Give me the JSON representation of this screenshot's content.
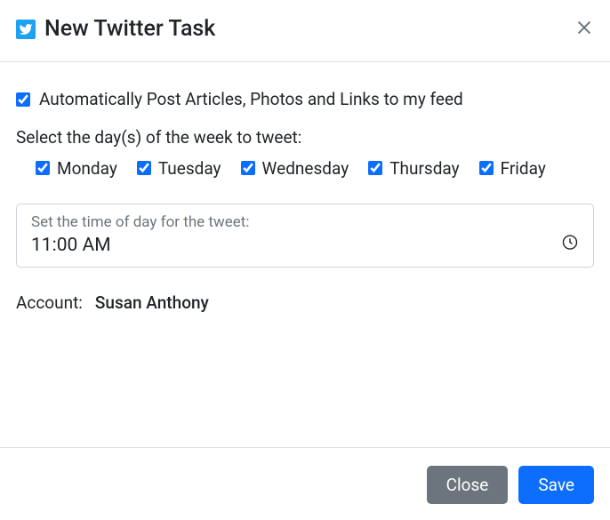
{
  "header": {
    "title": "New Twitter Task"
  },
  "body": {
    "auto_post": {
      "checked": true,
      "label": "Automatically Post Articles, Photos and Links to my feed"
    },
    "days_label": "Select the day(s) of the week to tweet:",
    "days": {
      "monday": {
        "label": "Monday",
        "checked": true
      },
      "tuesday": {
        "label": "Tuesday",
        "checked": true
      },
      "wednesday": {
        "label": "Wednesday",
        "checked": true
      },
      "thursday": {
        "label": "Thursday",
        "checked": true
      },
      "friday": {
        "label": "Friday",
        "checked": true
      }
    },
    "time": {
      "label": "Set the time of day for the tweet:",
      "value": "11:00 AM"
    },
    "account": {
      "label": "Account:",
      "value": "Susan Anthony"
    }
  },
  "footer": {
    "close_label": "Close",
    "save_label": "Save"
  }
}
